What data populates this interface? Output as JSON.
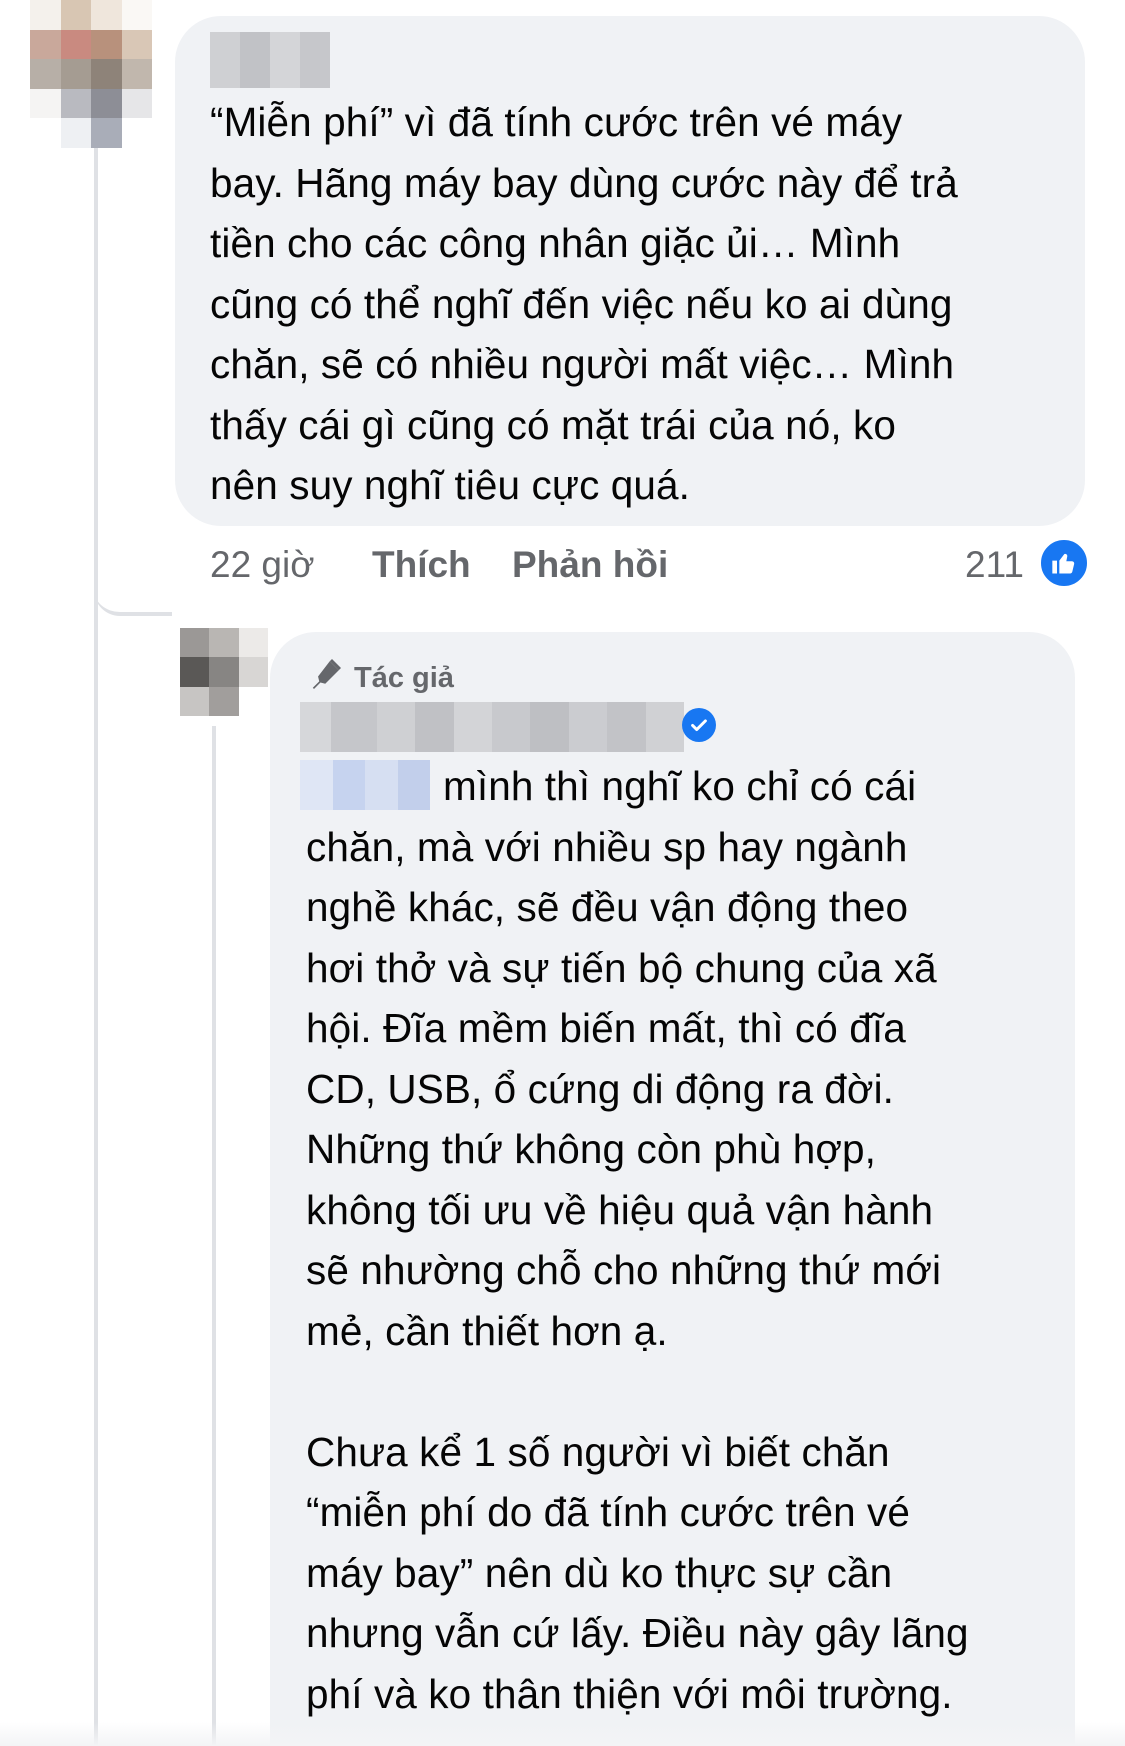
{
  "colors": {
    "bubble": "#f0f2f5",
    "text": "#050505",
    "meta": "#65676b",
    "like_blue": "#1877f2",
    "thread_line": "#dfe1e5"
  },
  "comment1": {
    "author_name": "",
    "text": "“Miễn phí” vì đã tính cước trên vé máy\nbay. Hãng máy bay dùng cước này để trả\ntiền cho các công nhân giặc ủi… Mình\ncũng có thể nghĩ đến việc nếu ko ai dùng\nchăn, sẽ có nhiều người mất việc… Mình\nthấy cái gì cũng có mặt trái của nó, ko\nnên suy nghĩ tiêu cực quá.",
    "time": "22 giờ",
    "like_label": "Thích",
    "reply_label": "Phản hồi",
    "reaction_count": "211",
    "reaction_icon": "like-icon"
  },
  "reply1": {
    "author_badge": "Tác giả",
    "author_badge_icon": "pen-icon",
    "verified_icon": "verified-check-icon",
    "text": "mình thì nghĩ ko chỉ có cái\nchăn, mà với nhiều sp hay ngành\nnghề khác, sẽ đều vận động theo\nhơi thở và sự tiến bộ chung của xã\nhội. Đĩa mềm biến mất, thì có đĩa\nCD, USB, ổ cứng di động ra đời.\nNhững thứ không còn phù hợp,\nkhông tối ưu về hiệu quả vận hành\nsẽ nhường chỗ cho những thứ mới\nmẻ, cần thiết hơn ạ.\n\nChưa kể 1 số người vì biết chăn\n“miễn phí do đã tính cước trên vé\nmáy bay” nên dù ko thực sự cần\nnhưng vẫn cứ lấy. Điều này gây lãng\nphí và ko thân thiện với môi trường."
  }
}
